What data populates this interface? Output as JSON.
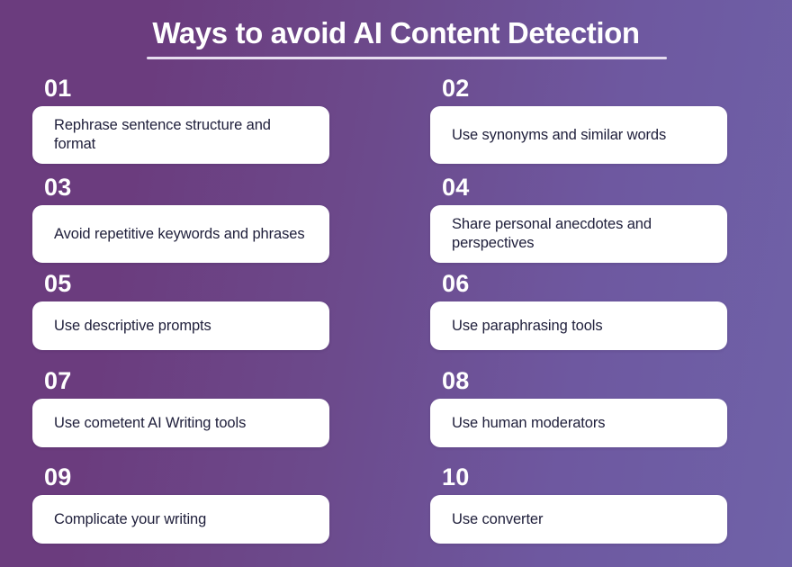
{
  "header": {
    "title": "Ways to avoid AI Content Detection"
  },
  "theme": {
    "gradient_start": "#6B3C7E",
    "gradient_end": "#6F62A8",
    "card_background": "#FFFFFF",
    "card_text_color": "#20203C",
    "number_color": "#FFFFFF",
    "rule_color": "#E6DDEF"
  },
  "items": [
    {
      "number": "01",
      "text": "Rephrase sentence structure and format",
      "lines": 2
    },
    {
      "number": "02",
      "text": "Use synonyms and similar words",
      "lines": 2
    },
    {
      "number": "03",
      "text": "Avoid repetitive keywords and phrases",
      "lines": 2
    },
    {
      "number": "04",
      "text": "Share personal anecdotes and perspectives",
      "lines": 2
    },
    {
      "number": "05",
      "text": "Use descriptive prompts",
      "lines": 1
    },
    {
      "number": "06",
      "text": "Use paraphrasing tools",
      "lines": 1
    },
    {
      "number": "07",
      "text": "Use cometent AI Writing tools",
      "lines": 1
    },
    {
      "number": "08",
      "text": "Use human moderators",
      "lines": 1
    },
    {
      "number": "09",
      "text": "Complicate your writing",
      "lines": 1
    },
    {
      "number": "10",
      "text": "Use converter",
      "lines": 1
    }
  ]
}
